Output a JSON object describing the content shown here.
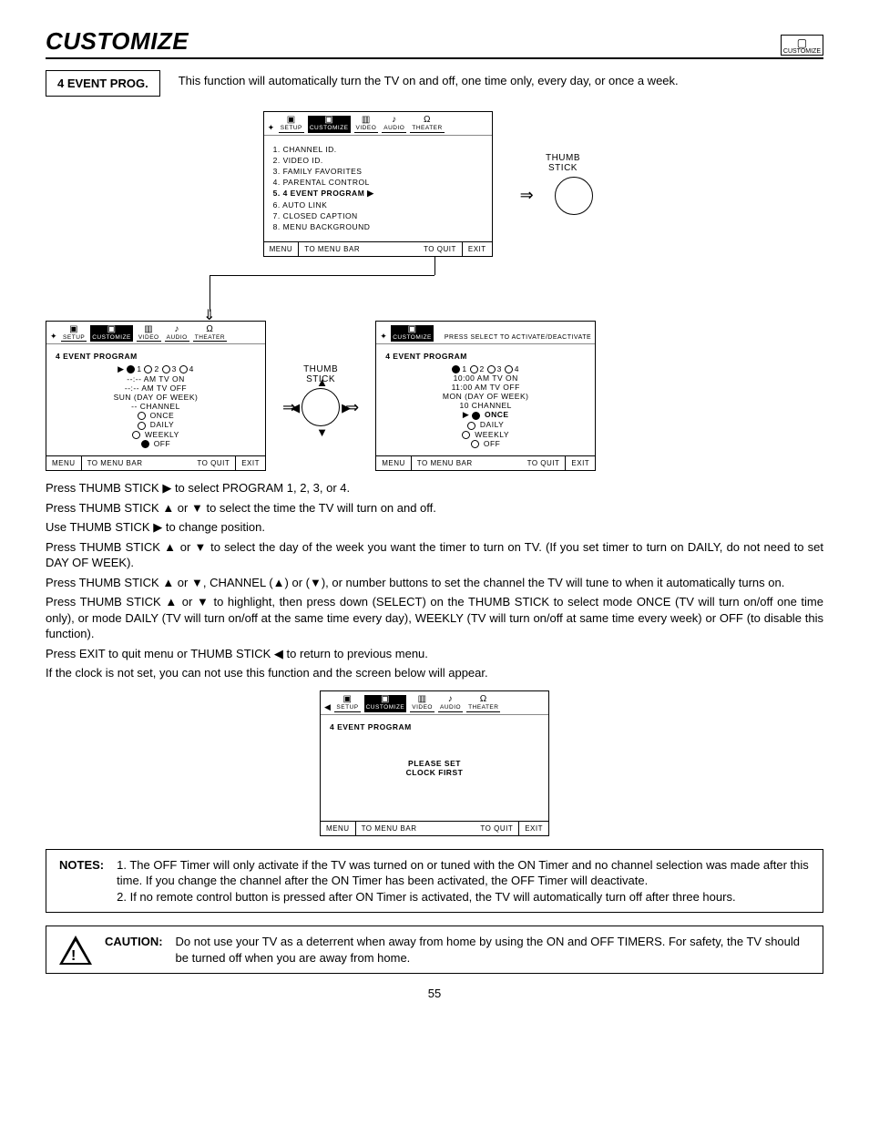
{
  "header": {
    "title": "CUSTOMIZE",
    "corner_label": "CUSTOMIZE"
  },
  "section": {
    "label": "4 EVENT PROG.",
    "intro": "This function will automatically turn the TV on and off, one time only, every day, or once a week."
  },
  "tabs": [
    "SETUP",
    "CUSTOMIZE",
    "VIDEO",
    "AUDIO",
    "THEATER"
  ],
  "screen1": {
    "items": [
      "1. CHANNEL ID.",
      "2. VIDEO ID.",
      "3. FAMILY FAVORITES",
      "4. PARENTAL CONTROL",
      "5. 4 EVENT PROGRAM",
      "6. AUTO LINK",
      "7. CLOSED CAPTION",
      "8. MENU BACKGROUND"
    ],
    "highlight_index": 4
  },
  "footer": {
    "menu": "MENU",
    "bar": "TO MENU BAR",
    "quit": "TO QUIT",
    "exit": "EXIT"
  },
  "thumb": {
    "label": "THUMB\nSTICK"
  },
  "screen2": {
    "title": "4 EVENT PROGRAM",
    "opts_label": "1   2   3   4",
    "lines": [
      "--:-- AM TV ON",
      "--:-- AM TV OFF",
      "SUN (DAY OF WEEK)",
      "-- CHANNEL"
    ],
    "modes": [
      "ONCE",
      "DAILY",
      "WEEKLY",
      "OFF"
    ],
    "mode_selected": 3
  },
  "screen3": {
    "hint": "PRESS SELECT TO ACTIVATE/DEACTIVATE",
    "title": "4 EVENT PROGRAM",
    "lines": [
      "10:00 AM TV ON",
      "11:00 AM TV OFF",
      "MON (DAY OF WEEK)",
      "10 CHANNEL"
    ],
    "modes": [
      "ONCE",
      "DAILY",
      "WEEKLY",
      "OFF"
    ],
    "mode_selected": 0
  },
  "screen4": {
    "title": "4 EVENT PROGRAM",
    "msg1": "PLEASE SET",
    "msg2": "CLOCK FIRST"
  },
  "instructions": [
    "Press THUMB STICK ▶ to select PROGRAM 1, 2, 3, or 4.",
    "Press THUMB STICK ▲ or ▼ to select the time the TV will turn on and off.",
    "Use THUMB STICK ▶ to change position.",
    "Press THUMB STICK ▲ or ▼ to select the day of the week you want the timer to turn on TV. (If you set timer to turn on DAILY, do not need to set DAY OF WEEK).",
    "Press THUMB STICK ▲ or ▼, CHANNEL (▲) or (▼), or number buttons to set the channel the TV will tune to when it automatically turns on.",
    "Press THUMB STICK ▲ or ▼ to highlight, then press down (SELECT) on the THUMB STICK to select mode ONCE (TV will turn on/off one time only), or mode DAILY (TV will turn on/off at the same time every day), WEEKLY (TV will turn on/off at same time every week) or OFF (to disable this function).",
    "Press EXIT to quit menu or THUMB STICK ◀ to return to previous menu.",
    "If the clock is not set, you can not use this function and the screen below will appear."
  ],
  "notes": {
    "label": "NOTES:",
    "items": [
      "1. The OFF Timer will only activate if the TV was turned on or tuned with the ON Timer and no channel selection was made after this time.  If you change the channel after the ON Timer has been activated, the OFF Timer will deactivate.",
      "2. If no remote control button is pressed after ON Timer is activated, the TV will automatically turn off after three hours."
    ]
  },
  "caution": {
    "label": "CAUTION:",
    "text": "Do not use your TV as a deterrent when away from home by using the ON and OFF TIMERS.  For safety, the TV should be turned off when you are away from home."
  },
  "page": "55"
}
